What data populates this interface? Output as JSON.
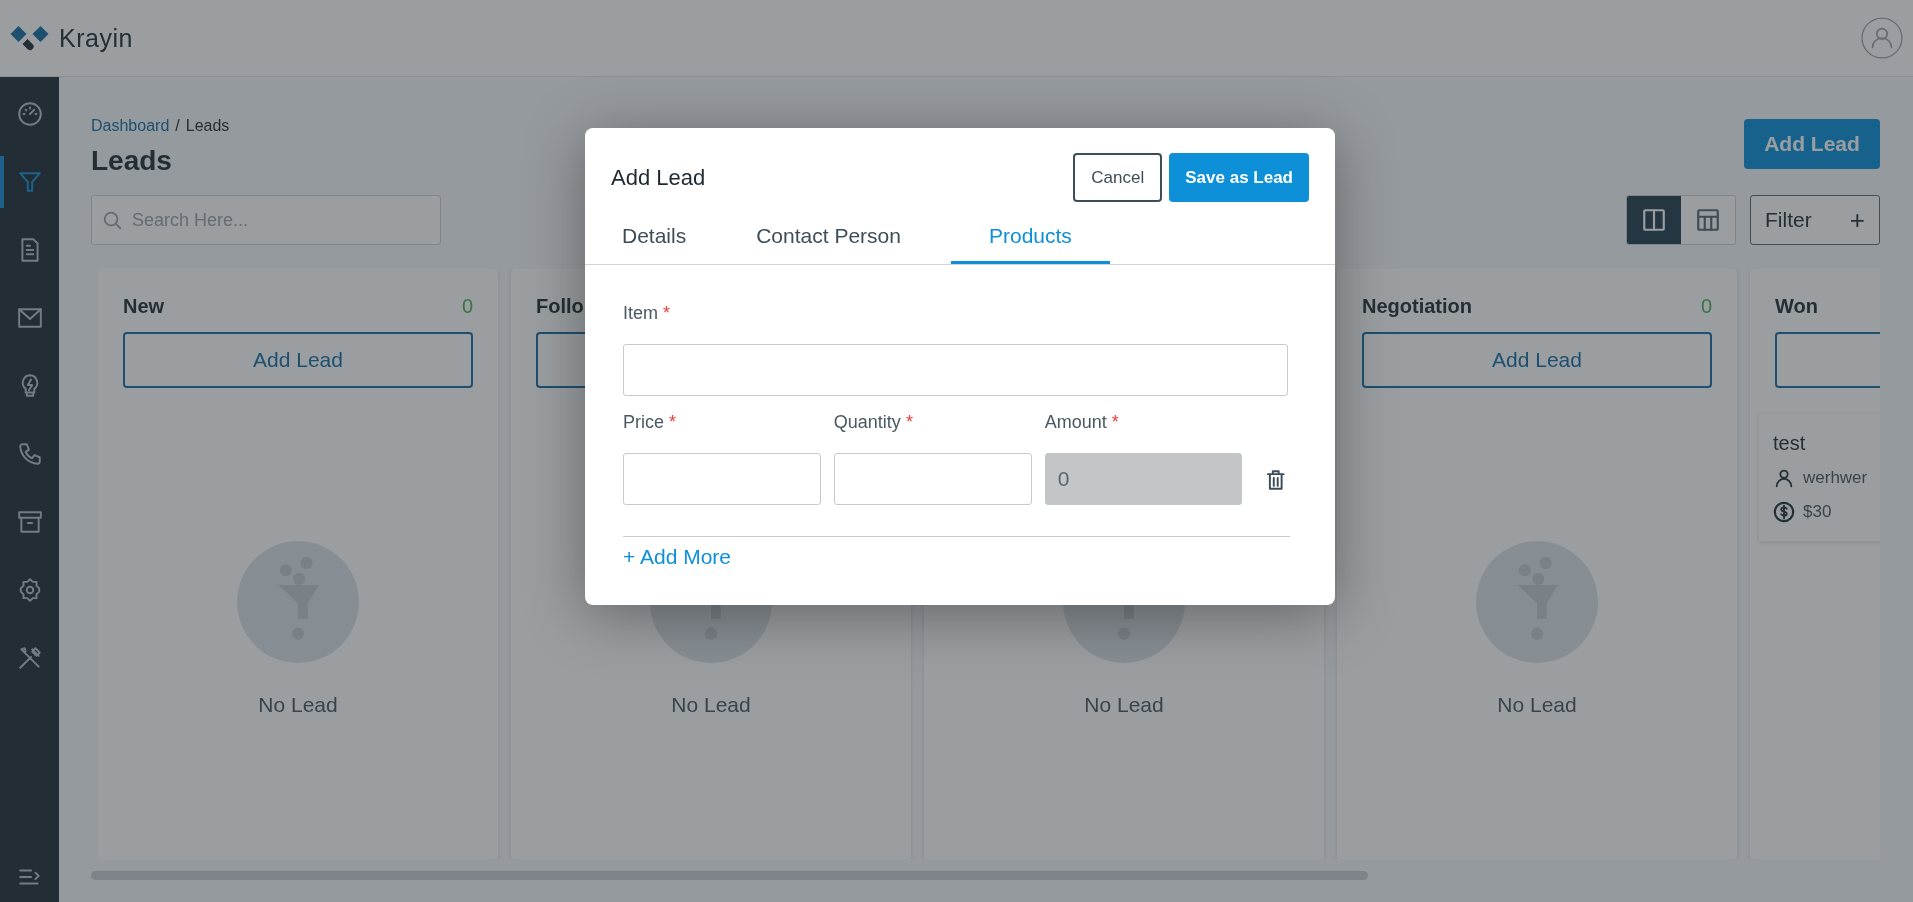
{
  "header": {
    "logo_text": "Krayin"
  },
  "sidebar": {
    "items": [
      {
        "kind": "dashboard",
        "selected": false
      },
      {
        "kind": "leads",
        "selected": true
      },
      {
        "kind": "quotes",
        "selected": false
      },
      {
        "kind": "mail",
        "selected": false
      },
      {
        "kind": "activities",
        "selected": false
      },
      {
        "kind": "contacts",
        "selected": false
      },
      {
        "kind": "products",
        "selected": false
      },
      {
        "kind": "settings",
        "selected": false
      },
      {
        "kind": "configuration",
        "selected": false
      }
    ]
  },
  "breadcrumb": {
    "items": [
      {
        "label": "Dashboard",
        "kind": "link"
      },
      {
        "label": "Leads",
        "kind": "current"
      }
    ],
    "separator": "/"
  },
  "page_title": "Leads",
  "add_lead_button": "Add Lead",
  "search": {
    "placeholder": "Search Here..."
  },
  "view_toggle": [
    {
      "kind": "kanban",
      "selected": true
    },
    {
      "kind": "table",
      "selected": false
    }
  ],
  "filter": {
    "label": "Filter",
    "plus": "+"
  },
  "columns": [
    {
      "title": "New",
      "count": "0",
      "has_add_button": true,
      "add_button": "Add Lead",
      "empty_text": "No Lead"
    },
    {
      "title": "Follo",
      "has_add_button": true,
      "empty_text": "No Lead"
    },
    {
      "empty_text": "No Lead"
    },
    {
      "title": "Negotiation",
      "count": "0",
      "has_add_button": true,
      "add_button": "Add Lead",
      "empty_text": "No Lead"
    },
    {
      "title": "Won",
      "has_add_button": true,
      "leads": [
        {
          "title": "test",
          "person": "werhwer",
          "amount": "$30"
        }
      ]
    }
  ],
  "modal": {
    "title": "Add Lead",
    "buttons": [
      {
        "label": "Cancel",
        "kind": "secondary"
      },
      {
        "label": "Save as Lead",
        "kind": "primary"
      }
    ],
    "tabs": [
      {
        "label": "Details",
        "selected": false
      },
      {
        "label": "Contact Person",
        "selected": false
      },
      {
        "label": "Products",
        "selected": true
      }
    ],
    "required_mark": "*",
    "item": {
      "label": "Item",
      "required": true
    },
    "price": {
      "label": "Price",
      "required": true
    },
    "quantity": {
      "label": "Quantity",
      "required": true
    },
    "amount": {
      "label": "Amount",
      "required": true,
      "value": "0",
      "disabled": true
    },
    "add_more": "+ Add More"
  }
}
